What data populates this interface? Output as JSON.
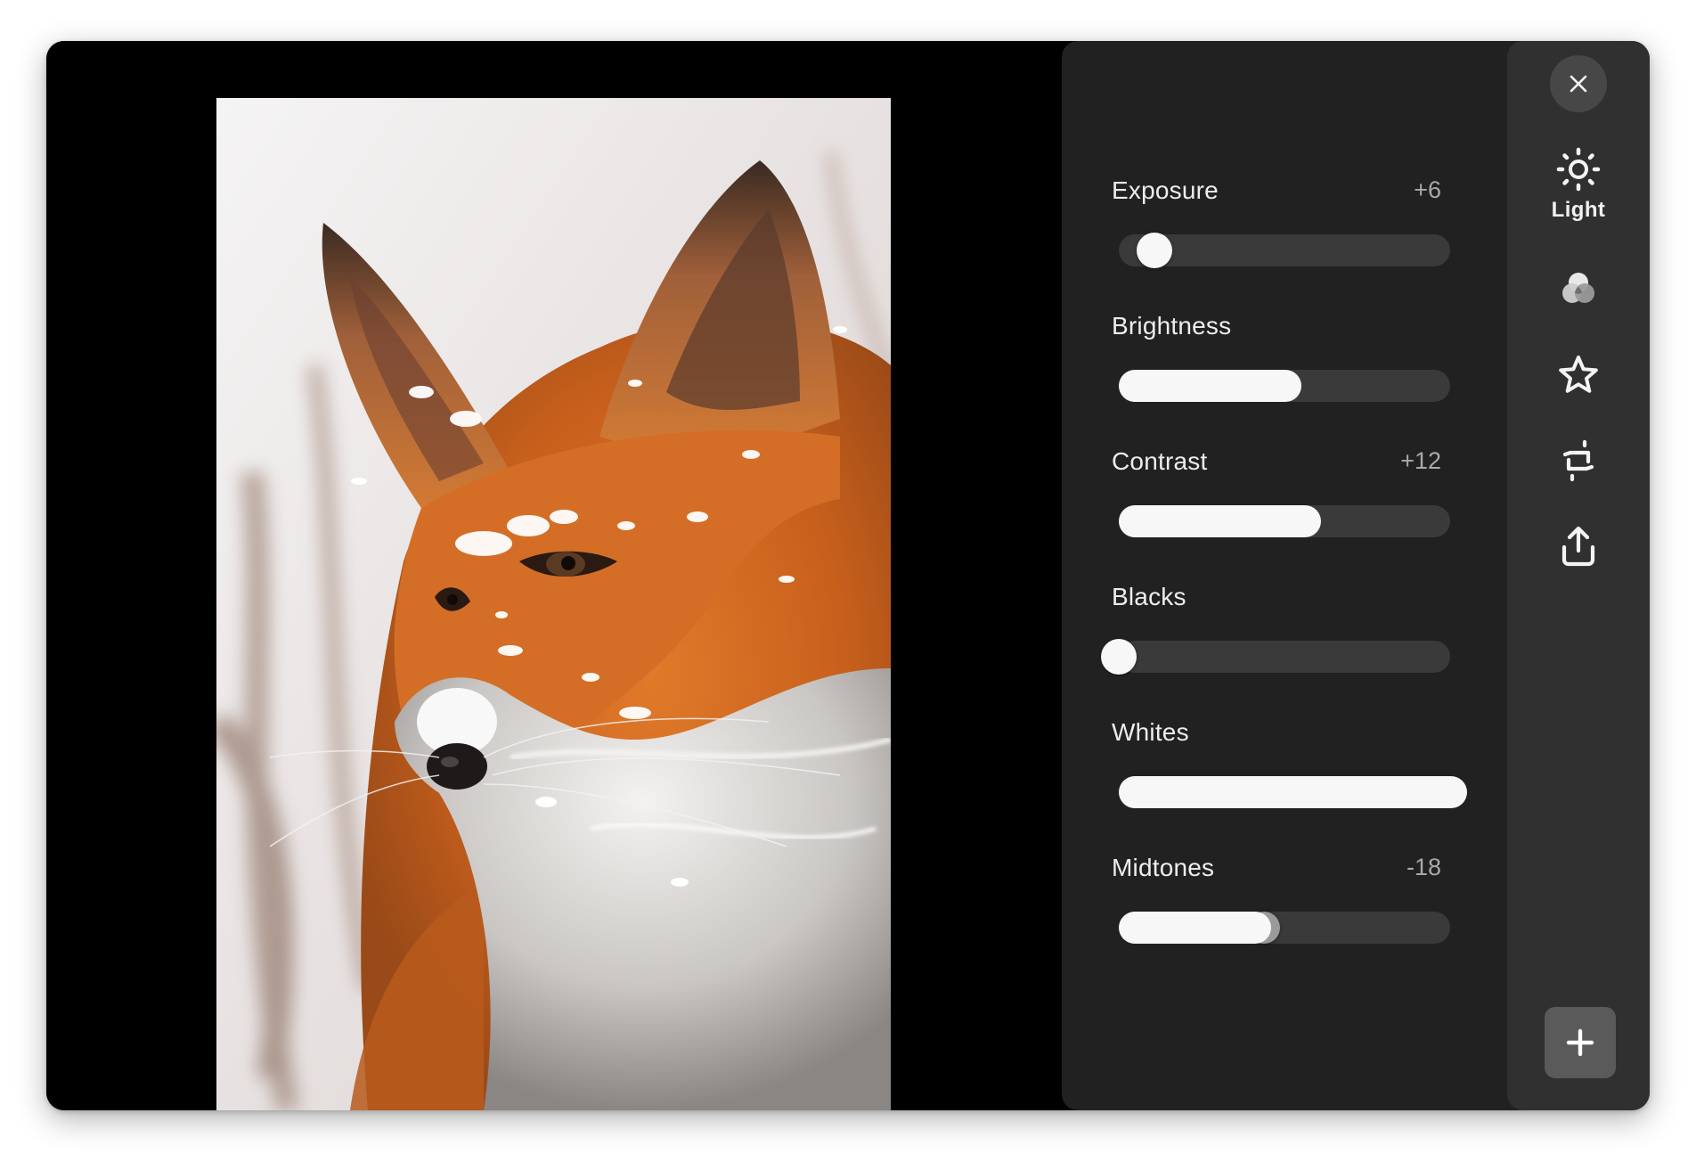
{
  "photo": {
    "subject": "red fox in snow"
  },
  "adjustments": [
    {
      "id": "exposure",
      "label": "Exposure",
      "value": "+6",
      "level": 0.06,
      "style": "knob"
    },
    {
      "id": "brightness",
      "label": "Brightness",
      "value": "",
      "level": 0.55,
      "style": "fill"
    },
    {
      "id": "contrast",
      "label": "Contrast",
      "value": "+12",
      "level": 0.61,
      "style": "fill"
    },
    {
      "id": "blacks",
      "label": "Blacks",
      "value": "",
      "level": 0.0,
      "style": "knob"
    },
    {
      "id": "whites",
      "label": "Whites",
      "value": "",
      "level": 1.05,
      "style": "fill"
    },
    {
      "id": "midtones",
      "label": "Midtones",
      "value": "-18",
      "level": 0.46,
      "style": "fill-knob"
    }
  ],
  "tools": {
    "close_icon": "close-icon",
    "items": [
      {
        "id": "light",
        "icon": "sun-icon",
        "label": "Light",
        "active": true
      },
      {
        "id": "color",
        "icon": "color-circles-icon",
        "label": "",
        "active": false
      },
      {
        "id": "effects",
        "icon": "star-icon",
        "label": "",
        "active": false
      },
      {
        "id": "crop",
        "icon": "crop-rotate-icon",
        "label": "",
        "active": false
      },
      {
        "id": "export",
        "icon": "share-icon",
        "label": "",
        "active": false
      }
    ],
    "add_icon": "plus-icon"
  },
  "colors": {
    "panel": "#212121",
    "rail": "#303030",
    "track": "#3a3a3a",
    "fill": "#f7f7f7",
    "label": "#ededed",
    "value": "#a9a9a9"
  }
}
